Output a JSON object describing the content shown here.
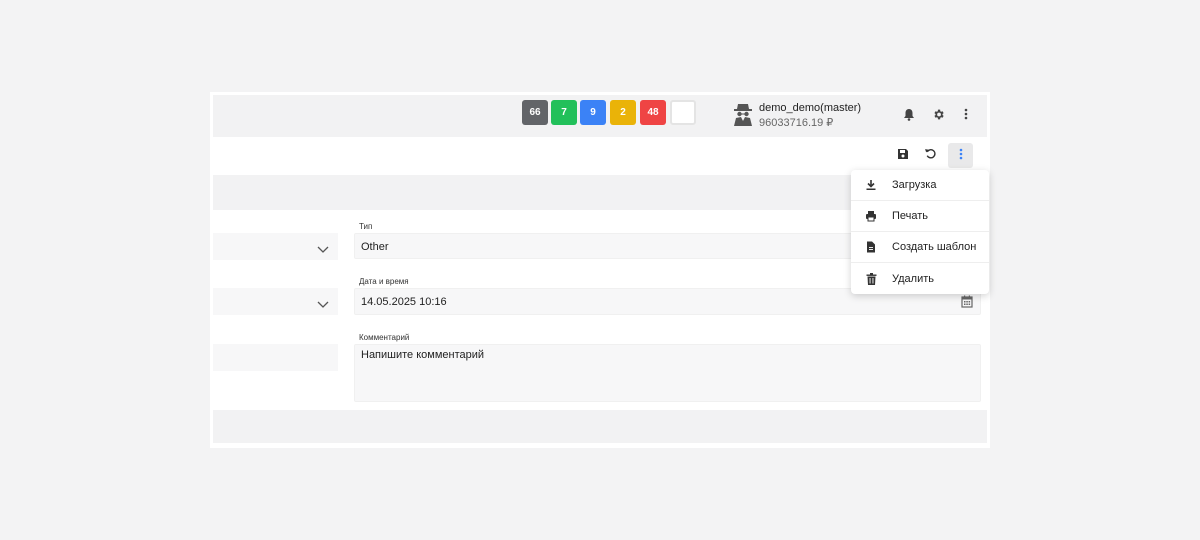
{
  "header": {
    "badges": [
      {
        "label": "66",
        "color": "#626468"
      },
      {
        "label": "7",
        "color": "#22c05a"
      },
      {
        "label": "9",
        "color": "#3b82f6"
      },
      {
        "label": "2",
        "color": "#eab308"
      },
      {
        "label": "48",
        "color": "#ef4444"
      },
      {
        "label": "",
        "color": "#ffffff"
      }
    ],
    "user_name": "demo_demo(master)",
    "balance": "96033716.19 ₽",
    "icons": [
      "bell-icon",
      "gear-icon",
      "more-vertical-icon"
    ]
  },
  "toolbar": {
    "icons": [
      "save-icon",
      "undo-icon",
      "more-vertical-icon"
    ],
    "accent": "#3b82f6"
  },
  "form": {
    "type_label": "Тип",
    "type_value": "Other",
    "datetime_label": "Дата и время",
    "datetime_value": "14.05.2025 10:16",
    "comment_label": "Комментарий",
    "comment_placeholder": "Напишите комментарий"
  },
  "menu": {
    "items": [
      {
        "label": "Загрузка",
        "icon": "download-icon"
      },
      {
        "label": "Печать",
        "icon": "printer-icon"
      },
      {
        "label": "Создать шаблон",
        "icon": "file-icon"
      },
      {
        "label": "Удалить",
        "icon": "trash-icon"
      }
    ]
  }
}
